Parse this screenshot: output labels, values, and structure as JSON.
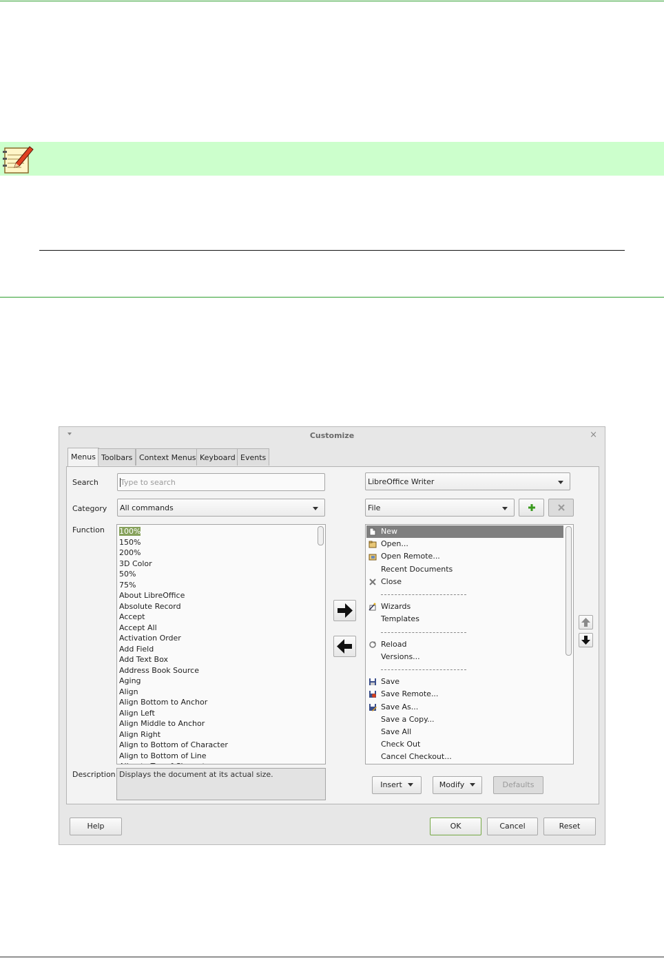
{
  "dialog": {
    "title": "Customize",
    "tabs": [
      "Menus",
      "Toolbars",
      "Context Menus",
      "Keyboard",
      "Events"
    ],
    "labels": {
      "search": "Search",
      "category": "Category",
      "function": "Function",
      "description": "Description"
    },
    "search_placeholder": "Type to search",
    "category_value": "All commands",
    "scope_value": "LibreOffice Writer",
    "menu_value": "File",
    "functions": [
      "100%",
      "150%",
      "200%",
      "3D Color",
      "50%",
      "75%",
      "About LibreOffice",
      "Absolute Record",
      "Accept",
      "Accept All",
      "Activation Order",
      "Add Field",
      "Add Text Box",
      "Address Book Source",
      "Aging",
      "Align",
      "Align Bottom to Anchor",
      "Align Left",
      "Align Middle to Anchor",
      "Align Right",
      "Align to Bottom of Character",
      "Align to Bottom of Line",
      "Align to Top of Character"
    ],
    "menu_entries": [
      {
        "label": "New",
        "icon": "new-document-icon",
        "selected": true
      },
      {
        "label": "Open...",
        "icon": "open-folder-icon"
      },
      {
        "label": "Open Remote...",
        "icon": "open-remote-icon"
      },
      {
        "label": "Recent Documents",
        "icon": ""
      },
      {
        "label": "Close",
        "icon": "close-x-icon"
      },
      {
        "label": "---",
        "separator": true
      },
      {
        "label": "Wizards",
        "icon": "wizard-icon"
      },
      {
        "label": "Templates",
        "icon": ""
      },
      {
        "label": "---",
        "separator": true
      },
      {
        "label": "Reload",
        "icon": "reload-icon"
      },
      {
        "label": "Versions...",
        "icon": ""
      },
      {
        "label": "---",
        "separator": true
      },
      {
        "label": "Save",
        "icon": "save-icon"
      },
      {
        "label": "Save Remote...",
        "icon": "save-remote-icon"
      },
      {
        "label": "Save As...",
        "icon": "save-as-icon"
      },
      {
        "label": "Save a Copy...",
        "icon": ""
      },
      {
        "label": "Save All",
        "icon": ""
      },
      {
        "label": "Check Out",
        "icon": ""
      },
      {
        "label": "Cancel Checkout...",
        "icon": ""
      }
    ],
    "description_text": "Displays the document at its actual size.",
    "buttons": {
      "insert": "Insert",
      "modify": "Modify",
      "defaults": "Defaults",
      "help": "Help",
      "ok": "OK",
      "cancel": "Cancel",
      "reset": "Reset"
    }
  },
  "colors": {
    "accent_green": "#2e9e2e",
    "note_band": "#ccffcc",
    "selection": "#86a15b"
  }
}
